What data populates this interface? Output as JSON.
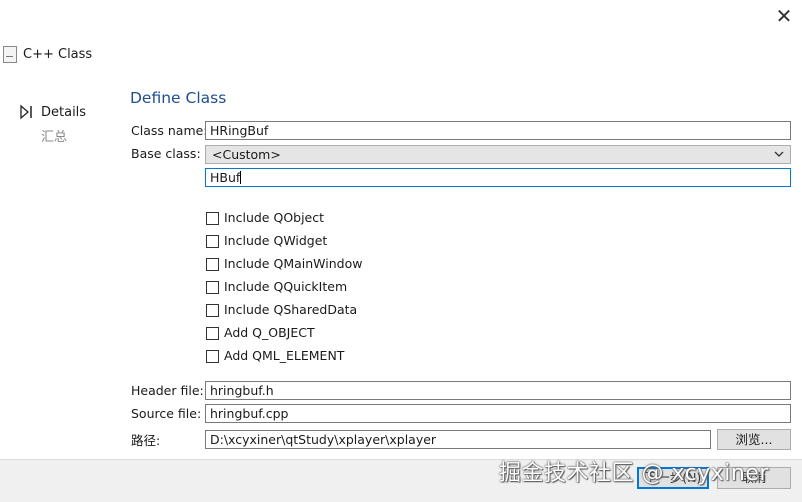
{
  "window": {
    "close_glyph": "✕"
  },
  "wizard": {
    "title": "C++ Class"
  },
  "steps": {
    "current": "Details",
    "summary": "汇总"
  },
  "page": {
    "title": "Define Class"
  },
  "form": {
    "class_name_label": "Class name:",
    "class_name_value": "HRingBuf",
    "base_class_label": "Base class:",
    "base_class_selected": "<Custom>",
    "custom_base_value": "HBuf",
    "checkboxes": [
      {
        "label": "Include QObject",
        "checked": false
      },
      {
        "label": "Include QWidget",
        "checked": false
      },
      {
        "label": "Include QMainWindow",
        "checked": false
      },
      {
        "label": "Include QQuickItem",
        "checked": false
      },
      {
        "label": "Include QSharedData",
        "checked": false
      },
      {
        "label": "Add Q_OBJECT",
        "checked": false
      },
      {
        "label": "Add QML_ELEMENT",
        "checked": false
      }
    ],
    "header_file_label": "Header file:",
    "header_file_value": "hringbuf.h",
    "source_file_label": "Source file:",
    "source_file_value": "hringbuf.cpp",
    "path_label": "路径:",
    "path_value": "D:\\xcyxiner\\qtStudy\\xplayer\\xplayer",
    "browse_label": "浏览..."
  },
  "footer": {
    "next_label": "下一步(N)",
    "cancel_label": "取消",
    "watermark": "掘金技术社区 @ xcyxiner"
  },
  "colors": {
    "accent": "#0078d7",
    "title": "#1f4e8f"
  }
}
